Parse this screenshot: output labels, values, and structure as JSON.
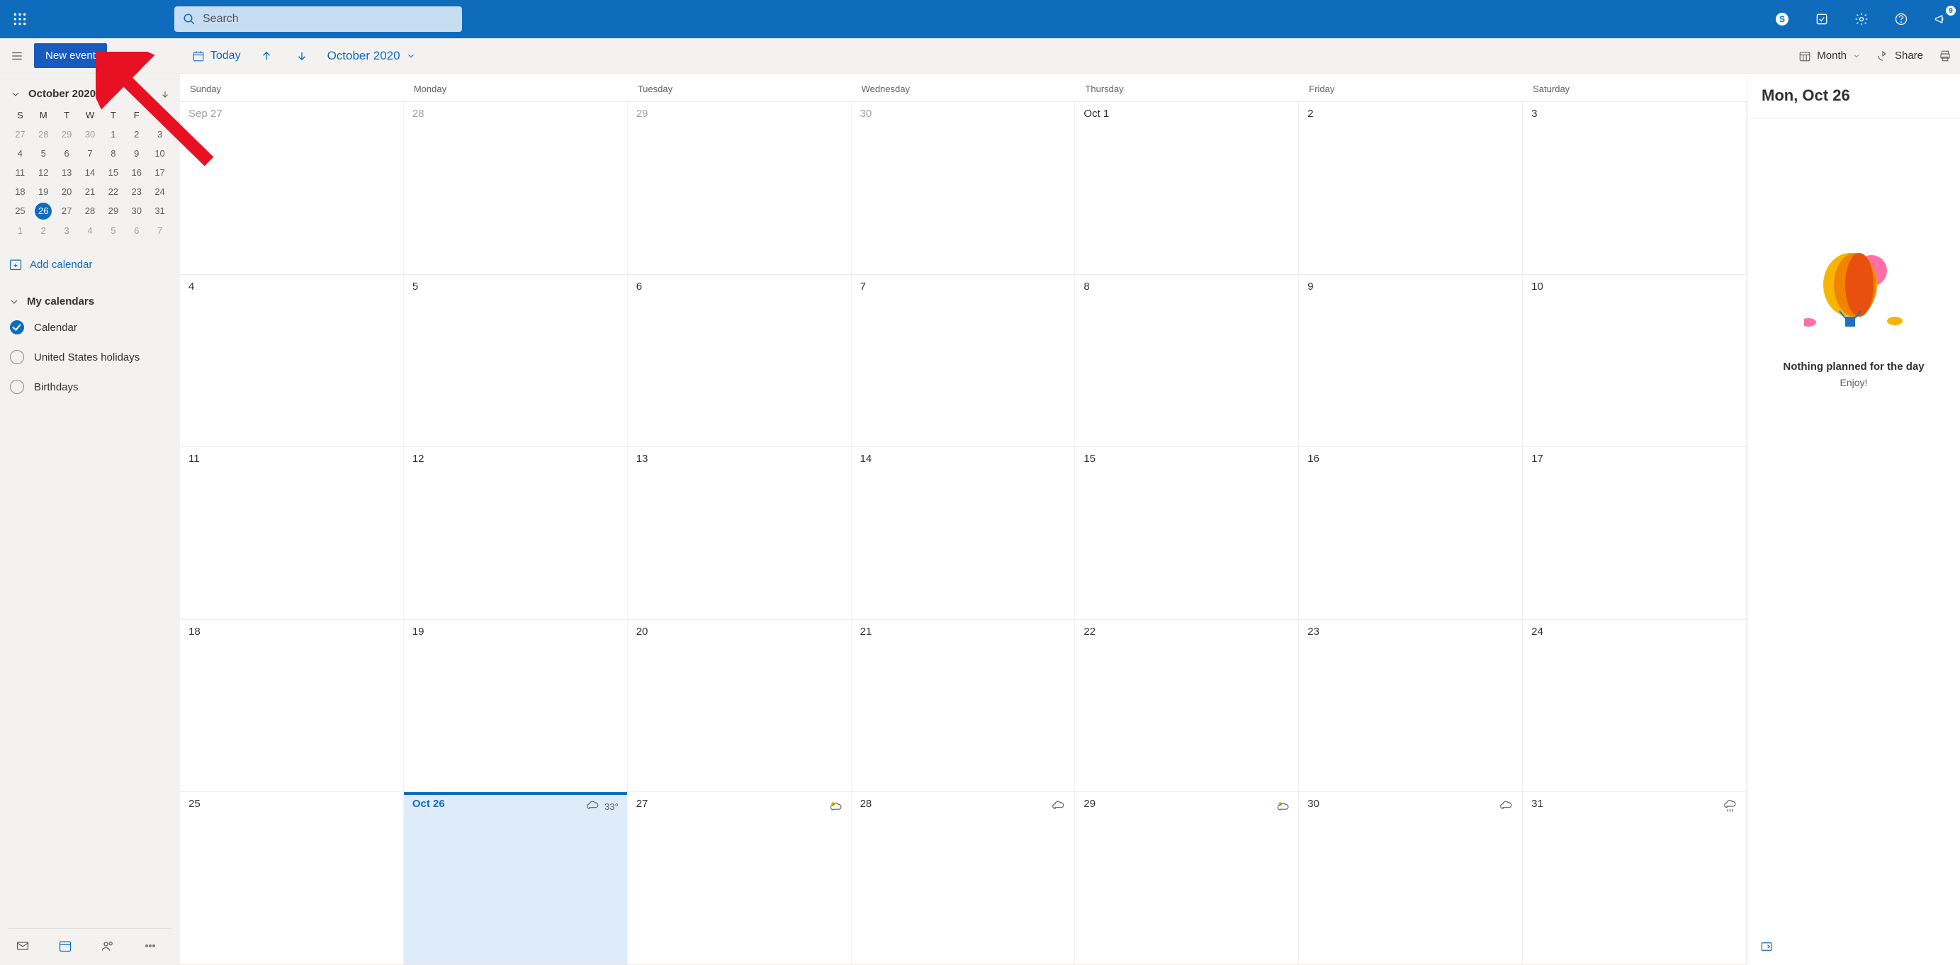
{
  "colors": {
    "primary": "#0F6CBD",
    "cmdbutton": "#185ABD",
    "panel": "#F3F2F1",
    "todaybg": "#DEECF9"
  },
  "topbar": {
    "search_placeholder": "Search",
    "notification_count": "9",
    "skype_label": "S"
  },
  "cmdbar": {
    "new_event": "New event",
    "today": "Today",
    "month_year": "October 2020",
    "view_label": "Month",
    "share_label": "Share"
  },
  "mini": {
    "title": "October 2020",
    "dow": [
      "S",
      "M",
      "T",
      "W",
      "T",
      "F",
      "S"
    ],
    "rows": [
      [
        {
          "n": "27",
          "dim": true
        },
        {
          "n": "28",
          "dim": true
        },
        {
          "n": "29",
          "dim": true
        },
        {
          "n": "30",
          "dim": true
        },
        {
          "n": "1"
        },
        {
          "n": "2"
        },
        {
          "n": "3"
        }
      ],
      [
        {
          "n": "4"
        },
        {
          "n": "5"
        },
        {
          "n": "6"
        },
        {
          "n": "7"
        },
        {
          "n": "8"
        },
        {
          "n": "9"
        },
        {
          "n": "10"
        }
      ],
      [
        {
          "n": "11"
        },
        {
          "n": "12"
        },
        {
          "n": "13"
        },
        {
          "n": "14"
        },
        {
          "n": "15"
        },
        {
          "n": "16"
        },
        {
          "n": "17"
        }
      ],
      [
        {
          "n": "18"
        },
        {
          "n": "19"
        },
        {
          "n": "20"
        },
        {
          "n": "21"
        },
        {
          "n": "22"
        },
        {
          "n": "23"
        },
        {
          "n": "24"
        }
      ],
      [
        {
          "n": "25"
        },
        {
          "n": "26",
          "today": true
        },
        {
          "n": "27"
        },
        {
          "n": "28"
        },
        {
          "n": "29"
        },
        {
          "n": "30"
        },
        {
          "n": "31"
        }
      ],
      [
        {
          "n": "1",
          "dim": true
        },
        {
          "n": "2",
          "dim": true
        },
        {
          "n": "3",
          "dim": true
        },
        {
          "n": "4",
          "dim": true
        },
        {
          "n": "5",
          "dim": true
        },
        {
          "n": "6",
          "dim": true
        },
        {
          "n": "7",
          "dim": true
        }
      ]
    ]
  },
  "add_calendar": "Add calendar",
  "my_calendars_label": "My calendars",
  "calendars": [
    {
      "label": "Calendar",
      "checked": true
    },
    {
      "label": "United States holidays",
      "checked": false
    },
    {
      "label": "Birthdays",
      "checked": false
    }
  ],
  "grid": {
    "dow": [
      "Sunday",
      "Monday",
      "Tuesday",
      "Wednesday",
      "Thursday",
      "Friday",
      "Saturday"
    ],
    "weeks": [
      [
        {
          "label": "Sep 27",
          "dim": true
        },
        {
          "label": "28",
          "dim": true
        },
        {
          "label": "29",
          "dim": true
        },
        {
          "label": "30",
          "dim": true
        },
        {
          "label": "Oct 1"
        },
        {
          "label": "2"
        },
        {
          "label": "3"
        }
      ],
      [
        {
          "label": "4"
        },
        {
          "label": "5"
        },
        {
          "label": "6"
        },
        {
          "label": "7"
        },
        {
          "label": "8"
        },
        {
          "label": "9"
        },
        {
          "label": "10"
        }
      ],
      [
        {
          "label": "11"
        },
        {
          "label": "12"
        },
        {
          "label": "13"
        },
        {
          "label": "14"
        },
        {
          "label": "15"
        },
        {
          "label": "16"
        },
        {
          "label": "17"
        }
      ],
      [
        {
          "label": "18"
        },
        {
          "label": "19"
        },
        {
          "label": "20"
        },
        {
          "label": "21"
        },
        {
          "label": "22"
        },
        {
          "label": "23"
        },
        {
          "label": "24"
        }
      ],
      [
        {
          "label": "25"
        },
        {
          "label": "Oct 26",
          "today": true,
          "weather": "33°",
          "wicon": "cloud"
        },
        {
          "label": "27",
          "wicon": "partly"
        },
        {
          "label": "28",
          "wicon": "cloud"
        },
        {
          "label": "29",
          "wicon": "partly"
        },
        {
          "label": "30",
          "wicon": "cloud"
        },
        {
          "label": "31",
          "wicon": "rain"
        }
      ]
    ]
  },
  "agenda": {
    "date_label": "Mon, Oct 26",
    "empty1": "Nothing planned for the day",
    "empty2": "Enjoy!"
  }
}
